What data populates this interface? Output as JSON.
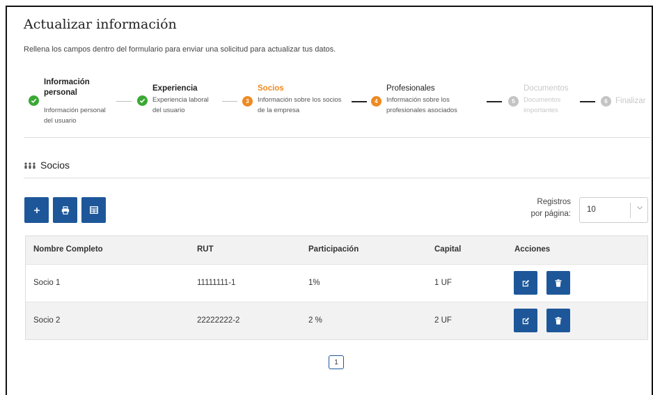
{
  "page": {
    "title": "Actualizar información",
    "subtitle": "Rellena los campos dentro del formulario para enviar una solicitud para actualizar tus datos."
  },
  "steps": [
    {
      "number": "",
      "title_l1": "Información",
      "title_l2": "personal",
      "desc_l1": "Información personal",
      "desc_l2": "del usuario",
      "state": "done"
    },
    {
      "number": "",
      "title": "Experiencia",
      "desc_l1": "Experiencia laboral",
      "desc_l2": "del usuario",
      "state": "done"
    },
    {
      "number": "3",
      "title": "Socios",
      "desc_l1": "Información sobre los socios",
      "desc_l2": "de la empresa",
      "state": "active"
    },
    {
      "number": "4",
      "title": "Profesionales",
      "desc_l1": "Información sobre los",
      "desc_l2": "profesionales asociados",
      "state": "active"
    },
    {
      "number": "5",
      "title": "Documentos",
      "desc_l1": "Documentos",
      "desc_l2": "importantes",
      "state": "pending"
    },
    {
      "number": "6",
      "title": "Finalizar",
      "state": "pending"
    }
  ],
  "section": {
    "icon": "people-group-icon",
    "title": "Socios"
  },
  "toolbar": {
    "buttons": [
      "add-icon",
      "print-icon",
      "table-icon"
    ],
    "registros_l1": "Registros",
    "registros_l2": "por página:",
    "page_size": "10"
  },
  "table": {
    "columns": [
      "Nombre Completo",
      "RUT",
      "Participación",
      "Capital",
      "Acciones"
    ],
    "rows": [
      {
        "nombre": "Socio 1",
        "rut": "11111111-1",
        "participacion": "1%",
        "capital": "1 UF"
      },
      {
        "nombre": "Socio 2",
        "rut": "22222222-2",
        "participacion": "2 %",
        "capital": "2 UF"
      }
    ]
  },
  "pagination": {
    "current": "1"
  },
  "colors": {
    "primary": "#1d5799",
    "done": "#3aa835",
    "active": "#ee8a22",
    "pending": "#c4c4c4"
  }
}
